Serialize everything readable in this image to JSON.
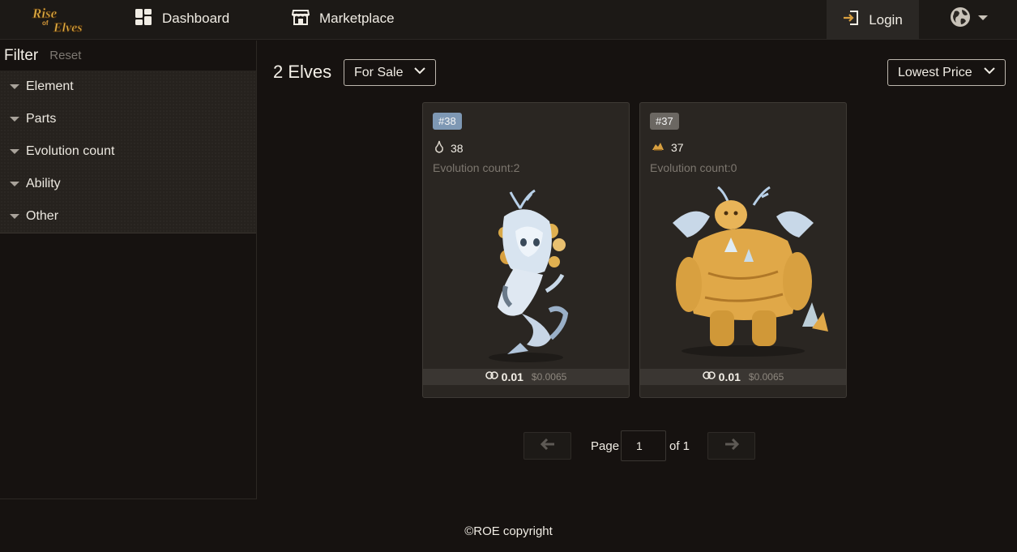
{
  "nav": {
    "logo_text": "Rise of Elves",
    "dashboard_label": "Dashboard",
    "marketplace_label": "Marketplace",
    "login_label": "Login"
  },
  "filter": {
    "title": "Filter",
    "reset_label": "Reset",
    "items": [
      "Element",
      "Parts",
      "Evolution count",
      "Ability",
      "Other"
    ]
  },
  "main": {
    "count_title": "2 Elves",
    "sale_filter": "For Sale",
    "sort_by": "Lowest Price"
  },
  "cards": [
    {
      "badge": "#38",
      "badge_color": "#7e98b4",
      "stat_value": "38",
      "evolution": "Evolution count:2",
      "price": "0.01",
      "price_usd": "$0.0065"
    },
    {
      "badge": "#37",
      "badge_color": "#6b6762",
      "stat_value": "37",
      "evolution": "Evolution count:0",
      "price": "0.01",
      "price_usd": "$0.0065"
    }
  ],
  "pagination": {
    "page_label": "Page",
    "current_page": "1",
    "of_label": "of 1"
  },
  "footer": {
    "copyright": "©ROE copyright"
  }
}
